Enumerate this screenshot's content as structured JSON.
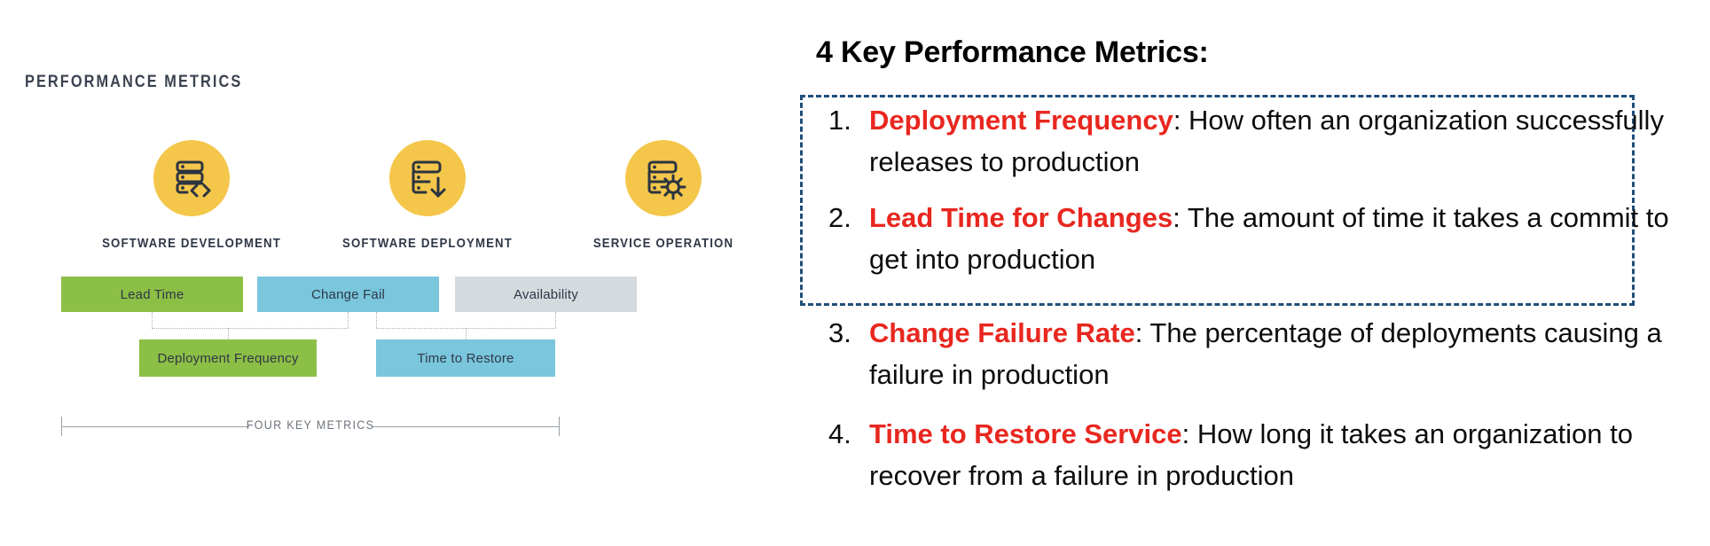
{
  "colors": {
    "icon_circle": "#f4c64a",
    "icon_glyph": "#2b3440",
    "bar_green": "#8cbf45",
    "bar_blue": "#79c6dd",
    "bar_grey": "#d4dade",
    "accent_red": "#e8271f",
    "dashed_border_blue": "#1f4e79",
    "heading_black": "#000000",
    "caption_dark": "#2f3847",
    "rule_grey": "#9aa1a9"
  },
  "left_panel": {
    "title": "PERFORMANCE METRICS",
    "stages": [
      {
        "icon": "server-code-icon",
        "label": "SOFTWARE DEVELOPMENT"
      },
      {
        "icon": "server-download-icon",
        "label": "SOFTWARE DEPLOYMENT"
      },
      {
        "icon": "server-gear-icon",
        "label": "SERVICE OPERATION"
      }
    ],
    "top_bars": [
      {
        "label": "Lead Time",
        "color": "green"
      },
      {
        "label": "Change Fail",
        "color": "blue"
      },
      {
        "label": "Availability",
        "color": "grey"
      }
    ],
    "bottom_bars": [
      {
        "label": "Deployment Frequency",
        "color": "green"
      },
      {
        "label": "Time to Restore",
        "color": "blue"
      }
    ],
    "bracket_label": "FOUR KEY METRICS"
  },
  "right_panel": {
    "heading": "4 Key Performance Metrics:",
    "items": [
      {
        "number": "1.",
        "term": "Deployment Frequency",
        "description": ": How often an organization successfully releases to production"
      },
      {
        "number": "2.",
        "term": "Lead Time for Changes",
        "description": ": The amount of time it takes a commit to get into production"
      },
      {
        "number": "3.",
        "term": "Change Failure Rate",
        "description": ": The percentage of deployments causing a failure in production"
      },
      {
        "number": "4.",
        "term": "Time to Restore Service",
        "description": ": How long it takes an organization to recover from a failure in production"
      }
    ]
  }
}
